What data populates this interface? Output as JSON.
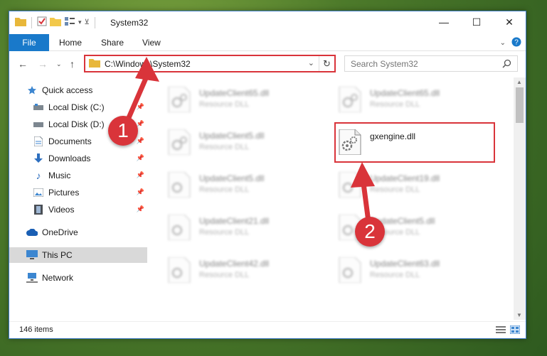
{
  "window": {
    "title": "System32",
    "controls": {
      "minimize": "—",
      "maximize": "☐",
      "close": "✕"
    }
  },
  "ribbon": {
    "tabs": [
      {
        "label": "File"
      },
      {
        "label": "Home"
      },
      {
        "label": "Share"
      },
      {
        "label": "View"
      }
    ]
  },
  "nav": {
    "address": "C:\\Windows\\System32",
    "search_placeholder": "Search System32"
  },
  "sidebar": {
    "items": [
      {
        "label": "Quick access",
        "icon": "star-icon",
        "pinned": false
      },
      {
        "label": "Local Disk (C:)",
        "icon": "drive-icon",
        "pinned": true
      },
      {
        "label": "Local Disk (D:)",
        "icon": "drive-icon",
        "pinned": true
      },
      {
        "label": "Documents",
        "icon": "document-icon",
        "pinned": true
      },
      {
        "label": "Downloads",
        "icon": "download-icon",
        "pinned": true
      },
      {
        "label": "Music",
        "icon": "music-icon",
        "pinned": true
      },
      {
        "label": "Pictures",
        "icon": "picture-icon",
        "pinned": true
      },
      {
        "label": "Videos",
        "icon": "video-icon",
        "pinned": true
      },
      {
        "label": "OneDrive",
        "icon": "cloud-icon",
        "pinned": false
      },
      {
        "label": "This PC",
        "icon": "computer-icon",
        "pinned": false,
        "selected": true
      },
      {
        "label": "Network",
        "icon": "network-icon",
        "pinned": false
      }
    ]
  },
  "files": [
    {
      "name": "UpdateClient65.dll",
      "type": "Resource DLL",
      "blurred": true
    },
    {
      "name": "UpdateClient65.dll",
      "type": "Resource DLL",
      "blurred": true
    },
    {
      "name": "UpdateClient5.dll",
      "type": "Resource DLL",
      "blurred": true
    },
    {
      "name": "gxengine.dll",
      "type": "",
      "blurred": false,
      "highlighted": true
    },
    {
      "name": "UpdateClient5.dll",
      "type": "Resource DLL",
      "blurred": true
    },
    {
      "name": "UpdateClient19.dll",
      "type": "Resource DLL",
      "blurred": true
    },
    {
      "name": "UpdateClient21.dll",
      "type": "Resource DLL",
      "blurred": true
    },
    {
      "name": "UpdateClient5.dll",
      "type": "Resource DLL",
      "blurred": true
    },
    {
      "name": "UpdateClient42.dll",
      "type": "Resource DLL",
      "blurred": true
    },
    {
      "name": "UpdateClient63.dll",
      "type": "Resource DLL",
      "blurred": true
    }
  ],
  "status": {
    "item_count": "146 items"
  },
  "annotations": {
    "step1": "1",
    "step2": "2",
    "color": "#d9343a"
  }
}
